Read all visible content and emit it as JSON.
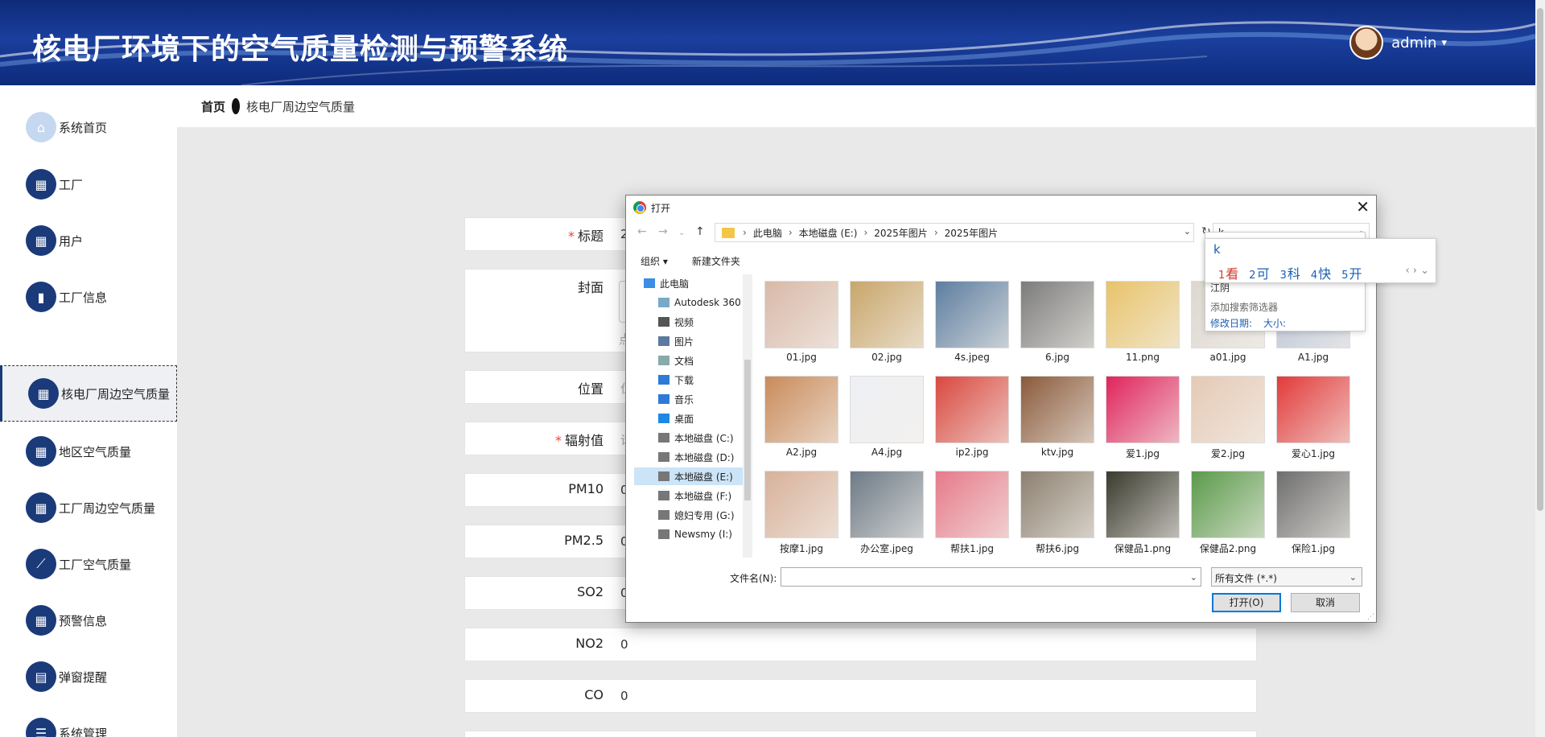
{
  "header": {
    "title": "核电厂环境下的空气质量检测与预警系统",
    "username": "admin",
    "caret": "▾"
  },
  "breadcrumb": {
    "home": "首页",
    "current": "核电厂周边空气质量"
  },
  "sidebar": {
    "items": [
      {
        "label": "系统首页",
        "icon": "home-icon",
        "glyph": "⌂"
      },
      {
        "label": "工厂",
        "icon": "grid-icon",
        "glyph": "▦"
      },
      {
        "label": "用户",
        "icon": "grid-icon",
        "glyph": "▦"
      },
      {
        "label": "工厂信息",
        "icon": "bar-chart-icon",
        "glyph": "▮"
      },
      {
        "label": "核电厂周边空气质量",
        "icon": "grid-icon",
        "glyph": "▦"
      },
      {
        "label": "地区空气质量",
        "icon": "grid-icon",
        "glyph": "▦"
      },
      {
        "label": "工厂周边空气质量",
        "icon": "grid-icon",
        "glyph": "▦"
      },
      {
        "label": "工厂空气质量",
        "icon": "line-chart-icon",
        "glyph": "⟋"
      },
      {
        "label": "预警信息",
        "icon": "grid-icon",
        "glyph": "▦"
      },
      {
        "label": "弹窗提醒",
        "icon": "clipboard-icon",
        "glyph": "▤"
      },
      {
        "label": "系统管理",
        "icon": "list-icon",
        "glyph": "☰"
      }
    ]
  },
  "form": {
    "rows": [
      {
        "label": "标题",
        "required": true,
        "value": "2",
        "placeholder": ""
      },
      {
        "label": "封面",
        "required": false,
        "value": "",
        "placeholder": "点"
      },
      {
        "label": "位置",
        "required": false,
        "value": "",
        "placeholder": "位"
      },
      {
        "label": "辐射值",
        "required": true,
        "value": "",
        "placeholder": "请"
      },
      {
        "label": "PM10",
        "required": false,
        "value": "0",
        "placeholder": ""
      },
      {
        "label": "PM2.5",
        "required": false,
        "value": "0",
        "placeholder": ""
      },
      {
        "label": "SO2",
        "required": false,
        "value": "0",
        "placeholder": ""
      },
      {
        "label": "NO2",
        "required": false,
        "value": "0",
        "placeholder": ""
      },
      {
        "label": "CO",
        "required": false,
        "value": "0",
        "placeholder": ""
      }
    ]
  },
  "dialog": {
    "title": "打开",
    "path": [
      "此电脑",
      "本地磁盘 (E:)",
      "2025年图片",
      "2025年图片"
    ],
    "search_value": "k",
    "organize": "组织 ▾",
    "new_folder": "新建文件夹",
    "tree": [
      {
        "label": "此电脑",
        "icon": "computer-icon",
        "color": "#3a8ee6"
      },
      {
        "label": "Autodesk 360",
        "icon": "cloud-icon",
        "color": "#7aa8c9"
      },
      {
        "label": "视频",
        "icon": "video-icon",
        "color": "#555"
      },
      {
        "label": "图片",
        "icon": "picture-icon",
        "color": "#5a7aa0"
      },
      {
        "label": "文档",
        "icon": "document-icon",
        "color": "#8aa"
      },
      {
        "label": "下载",
        "icon": "download-icon",
        "color": "#2d7bd6"
      },
      {
        "label": "音乐",
        "icon": "music-icon",
        "color": "#2d7bd6"
      },
      {
        "label": "桌面",
        "icon": "desktop-icon",
        "color": "#1e88e5"
      },
      {
        "label": "本地磁盘 (C:)",
        "icon": "drive-icon",
        "color": "#777"
      },
      {
        "label": "本地磁盘 (D:)",
        "icon": "drive-icon",
        "color": "#777"
      },
      {
        "label": "本地磁盘 (E:)",
        "icon": "drive-icon",
        "color": "#777"
      },
      {
        "label": "本地磁盘 (F:)",
        "icon": "drive-icon",
        "color": "#777"
      },
      {
        "label": "媳妇专用 (G:)",
        "icon": "drive-icon",
        "color": "#777"
      },
      {
        "label": "Newsmy (I:)",
        "icon": "drive-icon",
        "color": "#777"
      }
    ],
    "files": [
      {
        "name": "01.jpg",
        "color": "#d9b9a8"
      },
      {
        "name": "02.jpg",
        "color": "#c9a66b"
      },
      {
        "name": "4s.jpeg",
        "color": "#5d7ea0"
      },
      {
        "name": "6.jpg",
        "color": "#7c7c7c"
      },
      {
        "name": "11.png",
        "color": "#e8c36a"
      },
      {
        "name": "a01.jpg",
        "color": "#dcd7cf"
      },
      {
        "name": "A1.jpg",
        "color": "#b7c2d6"
      },
      {
        "name": "A2.jpg",
        "color": "#c98b5a"
      },
      {
        "name": "A4.jpg",
        "color": "#eef0f4"
      },
      {
        "name": "ip2.jpg",
        "color": "#d9483f"
      },
      {
        "name": "ktv.jpg",
        "color": "#8a5a3a"
      },
      {
        "name": "爱1.jpg",
        "color": "#e0245c"
      },
      {
        "name": "爱2.jpg",
        "color": "#e5c9b5"
      },
      {
        "name": "爱心1.jpg",
        "color": "#e23a3a"
      },
      {
        "name": "按摩1.jpg",
        "color": "#d8b19a"
      },
      {
        "name": "办公室.jpeg",
        "color": "#6d7a86"
      },
      {
        "name": "帮扶1.jpg",
        "color": "#e67a8a"
      },
      {
        "name": "帮扶6.jpg",
        "color": "#8c8070"
      },
      {
        "name": "保健品1.png",
        "color": "#3a3a2e"
      },
      {
        "name": "保健品2.png",
        "color": "#5a9a4a"
      },
      {
        "name": "保险1.jpg",
        "color": "#6e6e6e"
      }
    ],
    "filename_label": "文件名(N):",
    "filename_value": "",
    "filetype": "所有文件 (*.*)",
    "open_button": "打开(O)",
    "cancel_button": "取消"
  },
  "search_dropdown": {
    "history_item": "江阴",
    "add_filter": "添加搜索筛选器",
    "filter_date": "修改日期:",
    "filter_size": "大小:"
  },
  "ime": {
    "composition": "k",
    "candidates": [
      {
        "n": "1",
        "c": "看"
      },
      {
        "n": "2",
        "c": "可"
      },
      {
        "n": "3",
        "c": "科"
      },
      {
        "n": "4",
        "c": "快"
      },
      {
        "n": "5",
        "c": "开"
      }
    ],
    "arrows": "‹ › ⌄"
  }
}
